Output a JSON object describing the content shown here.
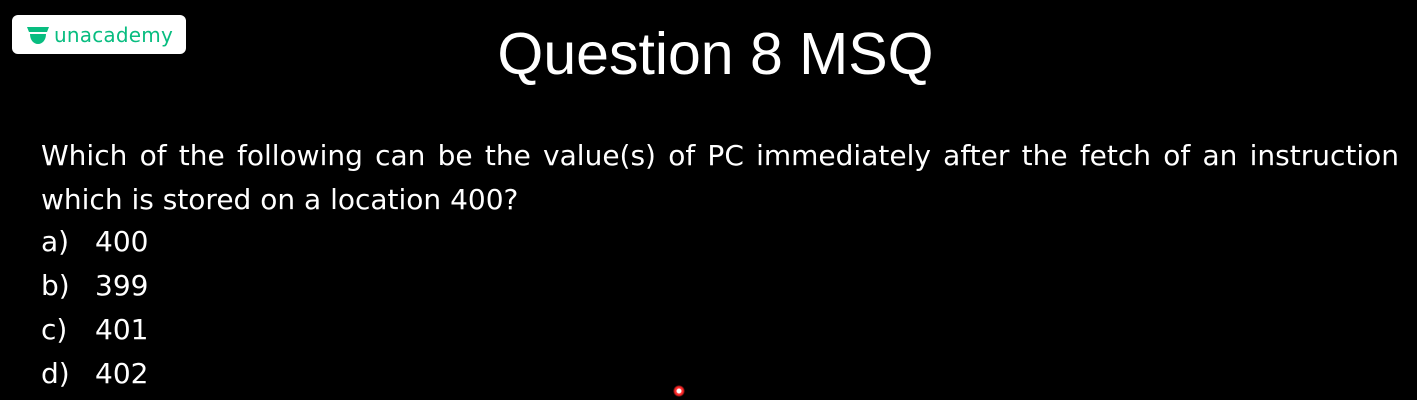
{
  "brand": {
    "name": "unacademy",
    "color": "#08bd80",
    "icon": "unacademy-logo-icon"
  },
  "slide": {
    "title": "Question 8 MSQ",
    "question": "Which of the following can be the value(s) of PC immediately after the fetch of an instruction which is stored on a location 400?",
    "options": [
      {
        "label": "a)",
        "value": "400"
      },
      {
        "label": "b)",
        "value": "399"
      },
      {
        "label": "c)",
        "value": "401"
      },
      {
        "label": "d)",
        "value": "402"
      }
    ]
  },
  "pointer": {
    "icon": "laser-pointer-dot",
    "color": "#ff2a2a"
  }
}
